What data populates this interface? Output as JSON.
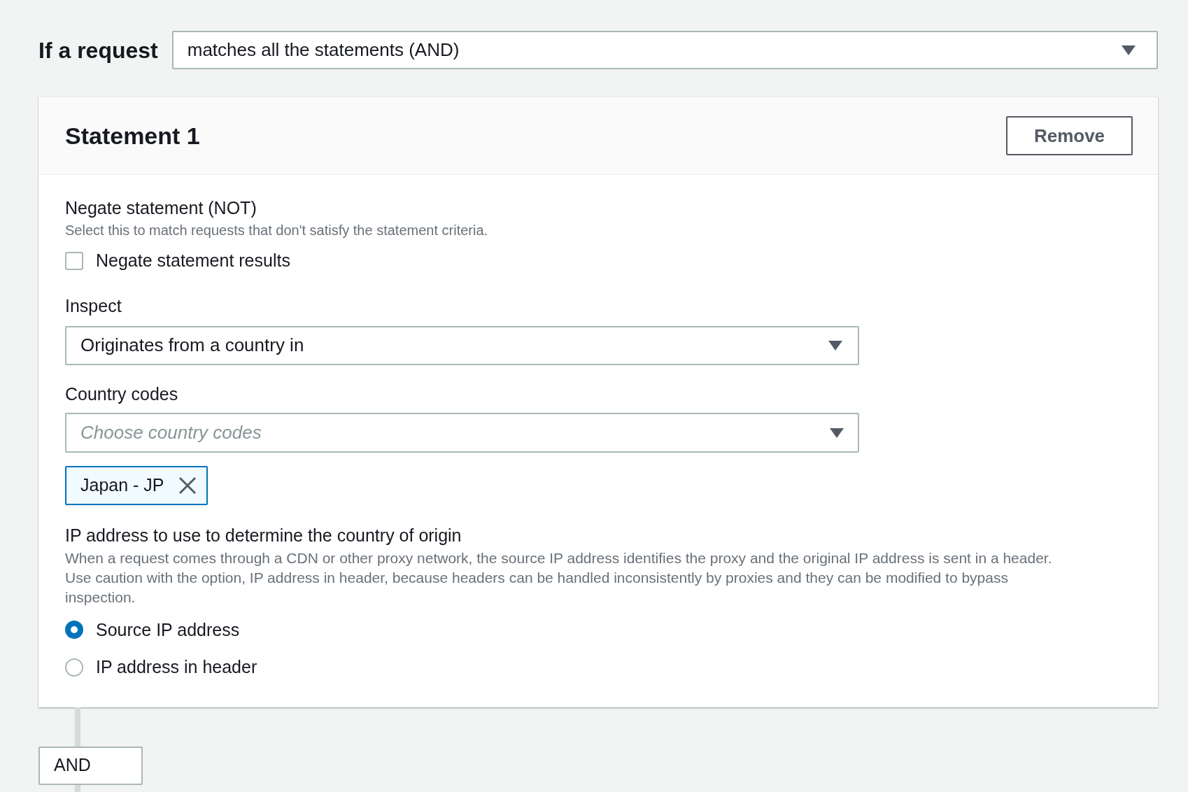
{
  "condition": {
    "label": "If a request",
    "value": "matches all the statements (AND)"
  },
  "statement": {
    "title": "Statement 1",
    "remove_button": "Remove",
    "negate": {
      "label": "Negate statement (NOT)",
      "description": "Select this to match requests that don't satisfy the statement criteria.",
      "checkbox_label": "Negate statement results",
      "checked": false
    },
    "inspect": {
      "label": "Inspect",
      "value": "Originates from a country in"
    },
    "country_codes": {
      "label": "Country codes",
      "placeholder": "Choose country codes",
      "tokens": [
        "Japan - JP"
      ]
    },
    "ip_source": {
      "label": "IP address to use to determine the country of origin",
      "description": "When a request comes through a CDN or other proxy network, the source IP address identifies the proxy and the original IP address is sent in a header. Use caution with the option, IP address in header, because headers can be handled inconsistently by proxies and they can be modified to bypass inspection.",
      "options": [
        {
          "label": "Source IP address",
          "selected": true
        },
        {
          "label": "IP address in header",
          "selected": false
        }
      ]
    }
  },
  "operator": "AND"
}
